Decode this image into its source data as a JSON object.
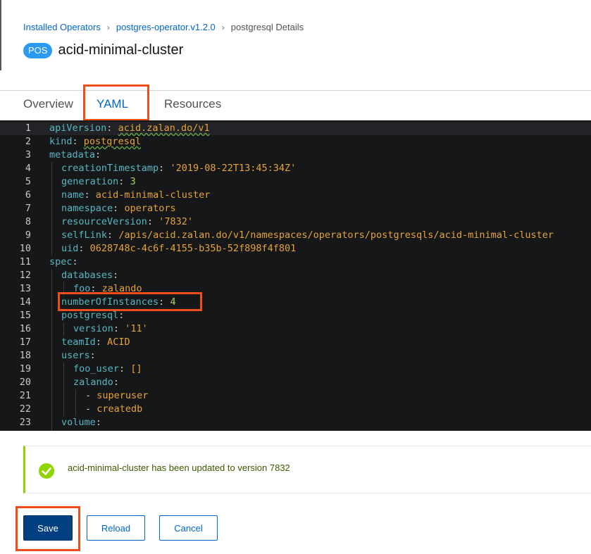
{
  "breadcrumb": {
    "installed_operators": "Installed Operators",
    "operator": "postgres-operator.v1.2.0",
    "current": "postgresql Details"
  },
  "resource": {
    "badge": "POS",
    "name": "acid-minimal-cluster"
  },
  "tabs": [
    {
      "label": "Overview"
    },
    {
      "label": "YAML"
    },
    {
      "label": "Resources"
    }
  ],
  "editor": {
    "lines": [
      {
        "num": "1",
        "key": "apiVersion",
        "value": "acid.zalan.do/v1",
        "indent": 0
      },
      {
        "num": "2",
        "key": "kind",
        "value": "postgresql",
        "indent": 0
      },
      {
        "num": "3",
        "key": "metadata",
        "value": "",
        "indent": 0
      },
      {
        "num": "4",
        "key": "creationTimestamp",
        "value": "'2019-08-22T13:45:34Z'",
        "indent": 1
      },
      {
        "num": "5",
        "key": "generation",
        "value": "3",
        "indent": 1
      },
      {
        "num": "6",
        "key": "name",
        "value": "acid-minimal-cluster",
        "indent": 1
      },
      {
        "num": "7",
        "key": "namespace",
        "value": "operators",
        "indent": 1
      },
      {
        "num": "8",
        "key": "resourceVersion",
        "value": "'7832'",
        "indent": 1
      },
      {
        "num": "9",
        "key": "selfLink",
        "value": "/apis/acid.zalan.do/v1/namespaces/operators/postgresqls/acid-minimal-cluster",
        "indent": 1
      },
      {
        "num": "10",
        "key": "uid",
        "value": "0628748c-4c6f-4155-b35b-52f898f4f801",
        "indent": 1
      },
      {
        "num": "11",
        "key": "spec",
        "value": "",
        "indent": 0
      },
      {
        "num": "12",
        "key": "databases",
        "value": "",
        "indent": 1
      },
      {
        "num": "13",
        "key": "foo",
        "value": "zalando",
        "indent": 2
      },
      {
        "num": "14",
        "key": "numberOfInstances",
        "value": "4",
        "indent": 1
      },
      {
        "num": "15",
        "key": "postgresql",
        "value": "",
        "indent": 1
      },
      {
        "num": "16",
        "key": "version",
        "value": "'11'",
        "indent": 2
      },
      {
        "num": "17",
        "key": "teamId",
        "value": "ACID",
        "indent": 1
      },
      {
        "num": "18",
        "key": "users",
        "value": "",
        "indent": 1
      },
      {
        "num": "19",
        "key": "foo_user",
        "value": "[]",
        "indent": 2
      },
      {
        "num": "20",
        "key": "zalando",
        "value": "",
        "indent": 2
      },
      {
        "num": "21",
        "key": "- superuser",
        "value": "",
        "indent": 3
      },
      {
        "num": "22",
        "key": "- createdb",
        "value": "",
        "indent": 3
      },
      {
        "num": "23",
        "key": "volume",
        "value": "",
        "indent": 1
      }
    ]
  },
  "alert": {
    "message": "acid-minimal-cluster has been updated to version 7832"
  },
  "buttons": {
    "save": "Save",
    "reload": "Reload",
    "cancel": "Cancel"
  },
  "colors": {
    "accent": "#0066cc",
    "primary_button": "#004080",
    "success": "#92d400",
    "annotation": "#ee4f1a"
  }
}
